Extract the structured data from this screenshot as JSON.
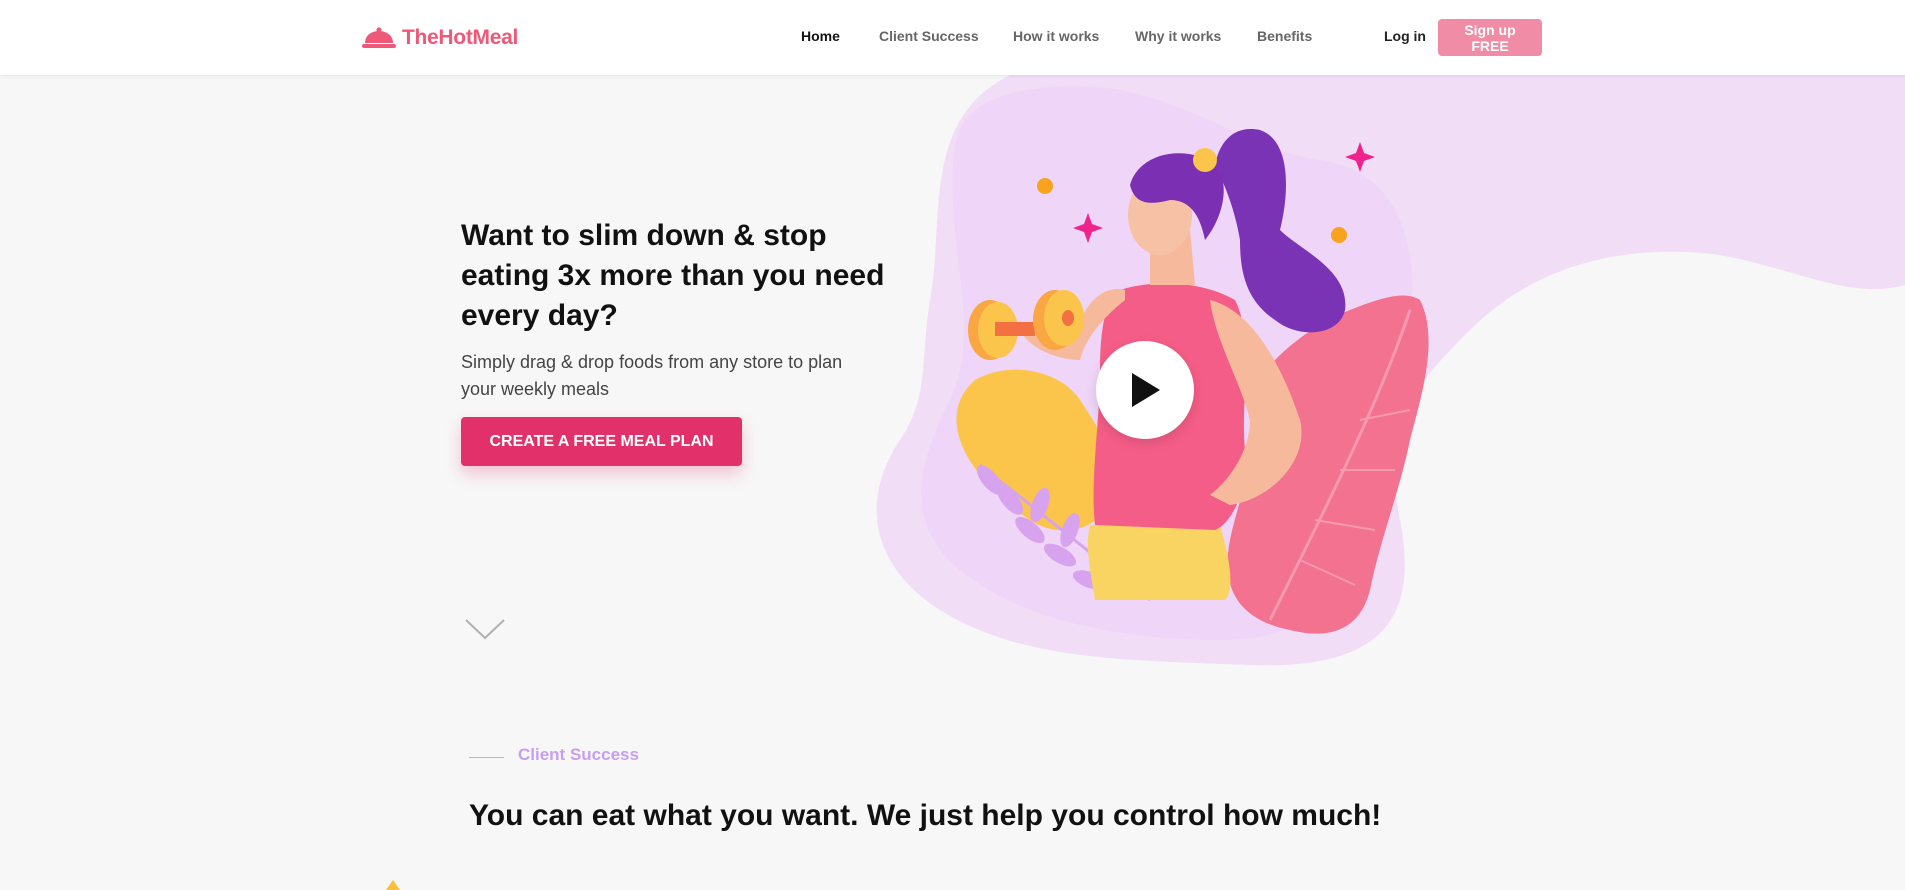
{
  "header": {
    "brand": "TheHotMeal",
    "nav": [
      {
        "label": "Home",
        "active": true
      },
      {
        "label": "Client Success",
        "active": false
      },
      {
        "label": "How it works",
        "active": false
      },
      {
        "label": "Why it works",
        "active": false
      },
      {
        "label": "Benefits",
        "active": false
      }
    ],
    "login_label": "Log in",
    "signup_label": "Sign up FREE"
  },
  "hero": {
    "title": "Want to slim down & stop eating 3x more than you need every day?",
    "subtitle": "Simply drag & drop foods from any store to plan your weekly meals",
    "cta_label": "CREATE A FREE MEAL PLAN"
  },
  "section": {
    "label": "Client Success",
    "title": "You can eat what you want. We just help you control how much!"
  },
  "colors": {
    "brand": "#f0587a",
    "cta": "#e2306b",
    "signup": "#f08ca6",
    "accent_purple": "#c89ef0"
  },
  "icons": {
    "logo": "cloche-icon",
    "play": "play-icon",
    "scroll": "chevron-down-icon"
  }
}
